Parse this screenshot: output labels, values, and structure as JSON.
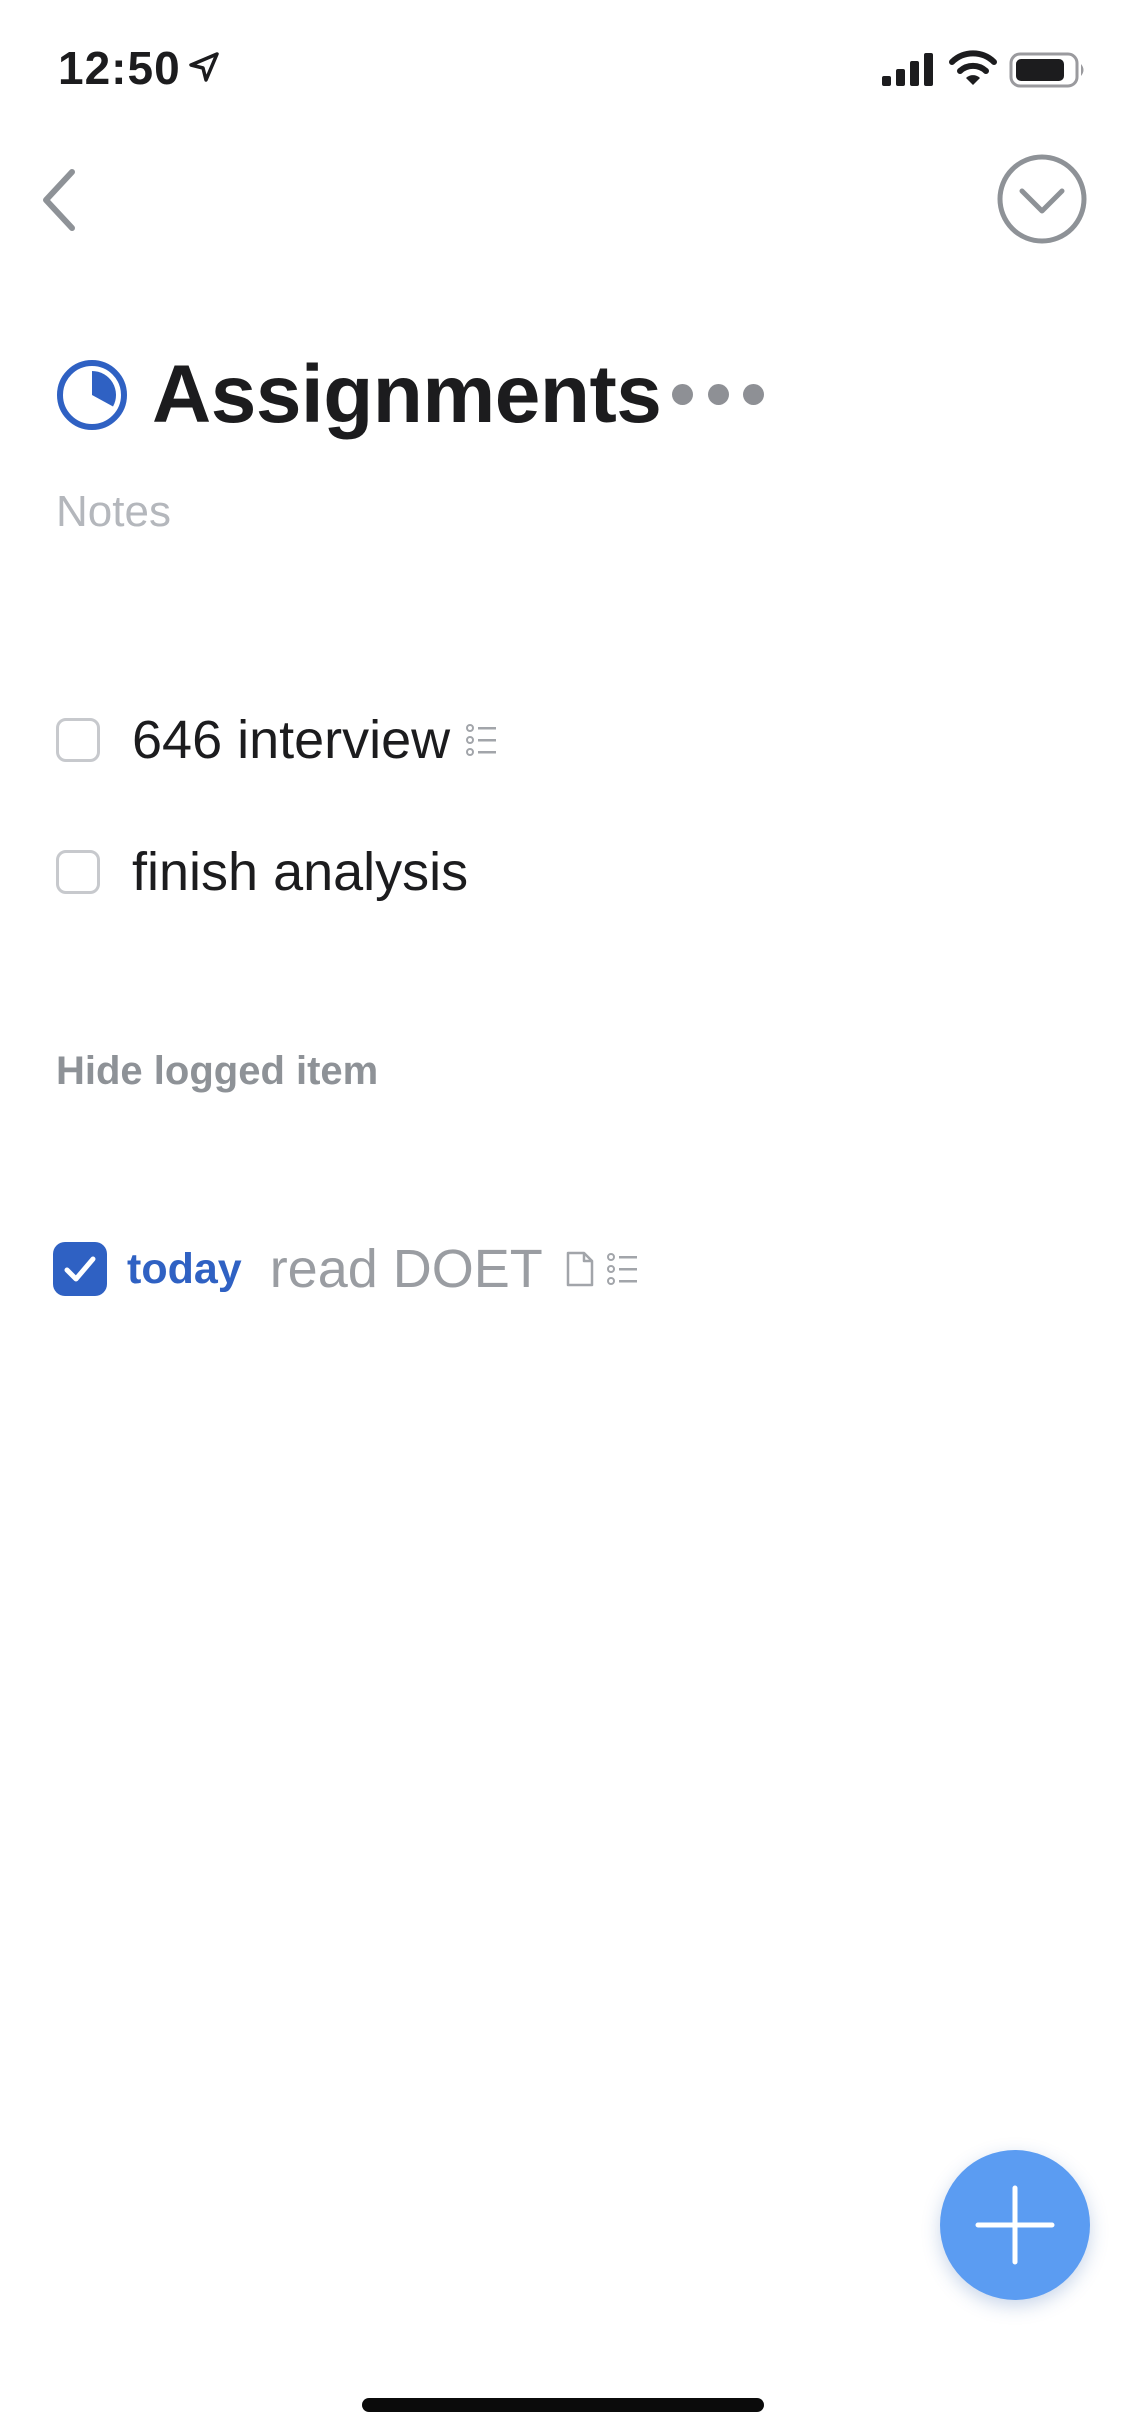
{
  "status_bar": {
    "time": "12:50",
    "location_icon": "location-arrow-icon",
    "signal_icon": "cellular-signal-icon",
    "wifi_icon": "wifi-icon",
    "battery_icon": "battery-icon"
  },
  "nav": {
    "back_icon": "chevron-left-icon",
    "complete_icon": "chevron-down-circle-icon"
  },
  "project": {
    "title": "Assignments",
    "progress_fraction": 0.33,
    "notes_placeholder": "Notes",
    "more_icon": "ellipsis-icon"
  },
  "todos": [
    {
      "label": "646 interview",
      "checked": false,
      "has_checklist": true
    },
    {
      "label": "finish analysis",
      "checked": false,
      "has_checklist": false
    }
  ],
  "logged_toggle": "Hide logged item",
  "logged_items": [
    {
      "when": "today",
      "label": "read DOET",
      "checked": true,
      "has_note": true,
      "has_checklist": true
    }
  ],
  "fab": {
    "icon": "plus-icon"
  },
  "colors": {
    "accent": "#2f61c3",
    "fab": "#5b9cf2",
    "muted": "#8e9297",
    "placeholder": "#b4b7bc"
  }
}
